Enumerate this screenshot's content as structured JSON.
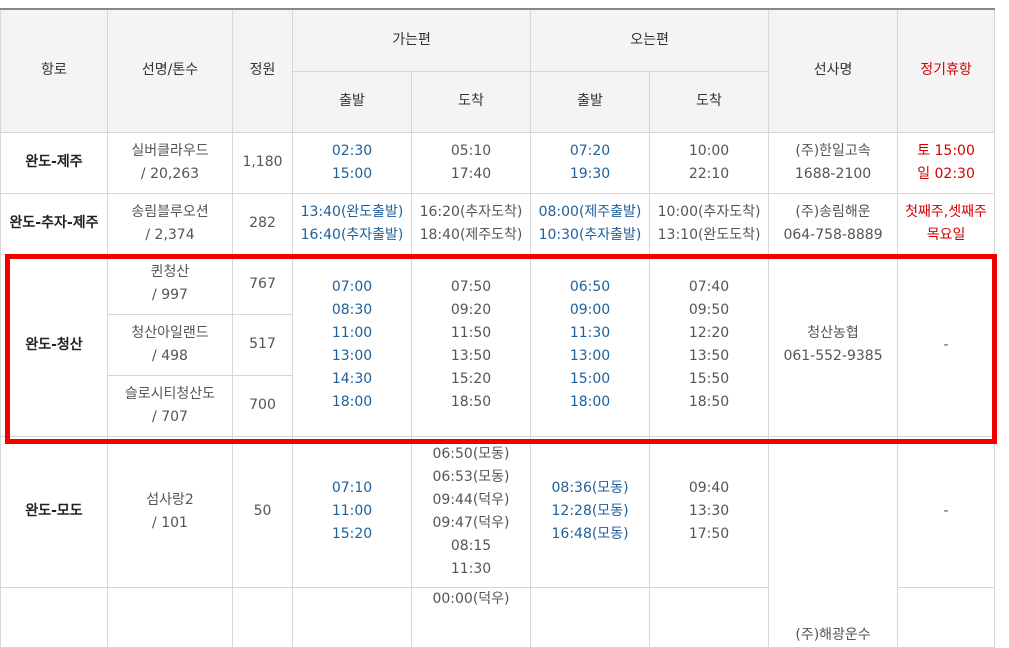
{
  "headers": {
    "route": "항로",
    "ship": "선명/톤수",
    "capacity": "정원",
    "outbound": "가는편",
    "inbound": "오는편",
    "depart": "출발",
    "arrive": "도착",
    "company": "선사명",
    "closed": "정기휴항"
  },
  "rows": [
    {
      "route": "완도-제주",
      "ship": "실버클라우드\n/ 20,263",
      "capacity": "1,180",
      "out_dep": "02:30\n15:00",
      "out_arr": "05:10\n17:40",
      "in_dep": "07:20\n19:30",
      "in_arr": "10:00\n22:10",
      "company": "(주)한일고속\n1688-2100",
      "closed": "토 15:00\n일 02:30"
    },
    {
      "route": "완도-추자-제주",
      "ship": "송림블루오션\n/ 2,374",
      "capacity": "282",
      "out_dep": "13:40(완도출발)\n16:40(추자출발)",
      "out_arr": "16:20(추자도착)\n18:40(제주도착)",
      "in_dep": "08:00(제주출발)\n10:30(추자출발)",
      "in_arr": "10:00(추자도착)\n13:10(완도도착)",
      "company": "(주)송림해운\n064-758-8889",
      "closed": "첫째주,셋째주\n목요일"
    },
    {
      "route": "완도-청산",
      "ships": [
        {
          "name": "퀸청산\n/ 997",
          "capacity": "767"
        },
        {
          "name": "청산아일랜드\n/ 498",
          "capacity": "517"
        },
        {
          "name": "슬로시티청산도\n/ 707",
          "capacity": "700"
        }
      ],
      "out_dep": "07:00\n08:30\n11:00\n13:00\n14:30\n18:00",
      "out_arr": "07:50\n09:20\n11:50\n13:50\n15:20\n18:50",
      "in_dep": "06:50\n09:00\n11:30\n13:00\n15:00\n18:00",
      "in_arr": "07:40\n09:50\n12:20\n13:50\n15:50\n18:50",
      "company": "청산농협\n061-552-9385",
      "closed": "-"
    },
    {
      "route": "완도-모도",
      "ship": "섬사랑2\n/ 101",
      "capacity": "50",
      "out_dep": "07:10\n11:00\n15:20",
      "out_arr": "06:50(모동)\n06:53(모동)\n09:44(덕우)\n09:47(덕우)\n08:15\n11:30",
      "in_dep": "08:36(모동)\n12:28(모동)\n16:48(모동)",
      "in_arr": "09:40\n13:30\n17:50",
      "closed": "-"
    }
  ],
  "partial_company": "(주)해광운수",
  "partial_out_arr": "00:00(덕우)"
}
